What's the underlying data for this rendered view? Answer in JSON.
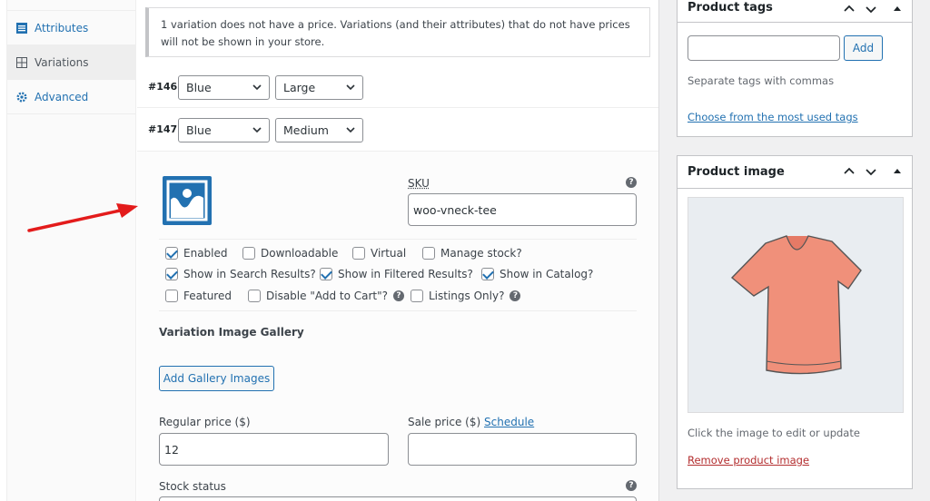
{
  "tabs": [
    {
      "label": "Attributes",
      "icon": "list-icon"
    },
    {
      "label": "Variations",
      "icon": "grid-icon"
    },
    {
      "label": "Advanced",
      "icon": "gear-icon"
    }
  ],
  "notice": "1 variation does not have a price. Variations (and their attributes) that do not have prices will not be shown in your store.",
  "variations": [
    {
      "id": "#146",
      "color": "Blue",
      "size": "Large"
    },
    {
      "id": "#147",
      "color": "Blue",
      "size": "Medium"
    }
  ],
  "variation_detail": {
    "sku_label": "SKU",
    "sku_value": "woo-vneck-tee",
    "checkboxes": {
      "enabled": {
        "label": "Enabled",
        "checked": true
      },
      "downloadable": {
        "label": "Downloadable",
        "checked": false
      },
      "virtual": {
        "label": "Virtual",
        "checked": false
      },
      "manage_stock": {
        "label": "Manage stock?",
        "checked": false
      },
      "show_search": {
        "label": "Show in Search Results?",
        "checked": true
      },
      "show_filtered": {
        "label": "Show in Filtered Results?",
        "checked": true
      },
      "show_catalog": {
        "label": "Show in Catalog?",
        "checked": true
      },
      "featured": {
        "label": "Featured",
        "checked": false
      },
      "disable_cart": {
        "label": "Disable \"Add to Cart\"?",
        "checked": false
      },
      "listings_only": {
        "label": "Listings Only?",
        "checked": false
      }
    },
    "gallery_heading": "Variation Image Gallery",
    "gallery_button": "Add Gallery Images",
    "regular_price_label": "Regular price ($)",
    "regular_price_value": "12",
    "sale_price_label": "Sale price ($)",
    "schedule_link": "Schedule",
    "stock_status_label": "Stock status"
  },
  "product_tags": {
    "title": "Product tags",
    "add_button": "Add",
    "hint": "Separate tags with commas",
    "choose_link": "Choose from the most used tags"
  },
  "product_image": {
    "title": "Product image",
    "hint": "Click the image to edit or update",
    "remove_link": "Remove product image"
  },
  "colors": {
    "accent": "#2271b1",
    "arrow": "#e31b1b",
    "remove": "#b32d2e",
    "tshirt": "#f0907a"
  }
}
